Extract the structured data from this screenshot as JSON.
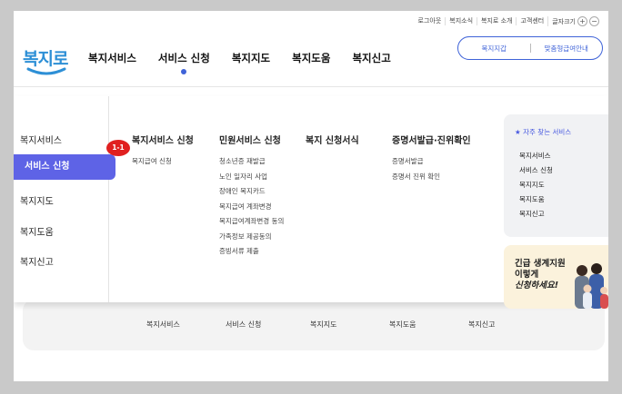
{
  "utility": {
    "items": [
      "로그아웃",
      "복지소식",
      "복지로 소개",
      "고객센터",
      "글자크기"
    ],
    "plus": "+",
    "minus": "−"
  },
  "logo": {
    "text": "복지로"
  },
  "gnb": {
    "items": [
      "복지서비스",
      "서비스 신청",
      "복지지도",
      "복지도움",
      "복지신고"
    ],
    "active_index": 1
  },
  "pill": {
    "left": "복지지갑",
    "right": "맞춤형급여안내"
  },
  "mega": {
    "left_nav": [
      "복지서비스",
      "서비스 신청",
      "복지지도",
      "복지도움",
      "복지신고"
    ],
    "active_index": 1,
    "badge": "1-1",
    "columns": [
      {
        "head": "복지서비스 신청",
        "items": [
          "복지급여 신청"
        ]
      },
      {
        "head": "민원서비스 신청",
        "items": [
          "청소년증 재발급",
          "노인 일자리 사업",
          "장애인 복지카드",
          "복지급여 계좌변경",
          "복지급여계좌변경 동의",
          "가족정보 제공동의",
          "증빙서류 제출"
        ]
      },
      {
        "head": "복지 신청서식",
        "items": []
      },
      {
        "head": "증명서발급·진위확인",
        "items": [
          "증명서발급",
          "증명서 진위 확인"
        ]
      }
    ],
    "favorites": {
      "title": "자주 찾는 서비스",
      "items": [
        "복지서비스",
        "서비스 신청",
        "복지지도",
        "복지도움",
        "복지신고"
      ]
    },
    "promo": {
      "line1": "긴급 생계지원",
      "line2": "이렇게",
      "line3": "신청하세요!"
    }
  },
  "quick_bar": {
    "items": [
      "복지서비스",
      "서비스 신청",
      "복지지도",
      "복지도움",
      "복지신고"
    ]
  },
  "colors": {
    "accent": "#5e63e6",
    "brand_blue": "#2d8fd6",
    "badge_red": "#e02020"
  }
}
